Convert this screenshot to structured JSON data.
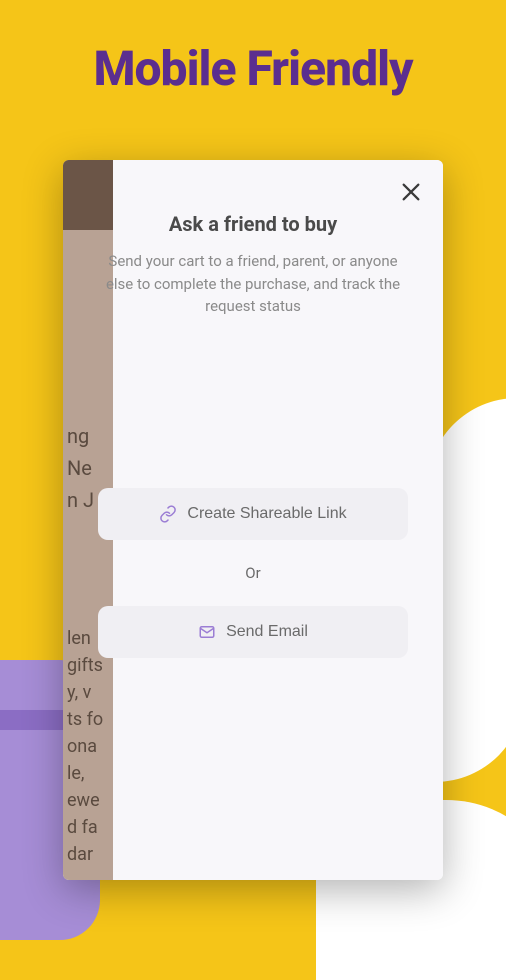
{
  "header": {
    "title": "Mobile Friendly"
  },
  "modal": {
    "title": "Ask a friend to buy",
    "description": "Send your cart to a friend, parent, or anyone else to complete the purchase, and track the request status",
    "createLinkLabel": "Create Shareable Link",
    "separator": "Or",
    "sendEmailLabel": "Send Email"
  },
  "background": {
    "peekText1Line1": "ng",
    "peekText1Line2": "Ne",
    "peekText1Line3": "n J",
    "peekText2": "len\ngifts\ny, v\nts fo\nona\nle,\newe\nd fa\ndar"
  }
}
